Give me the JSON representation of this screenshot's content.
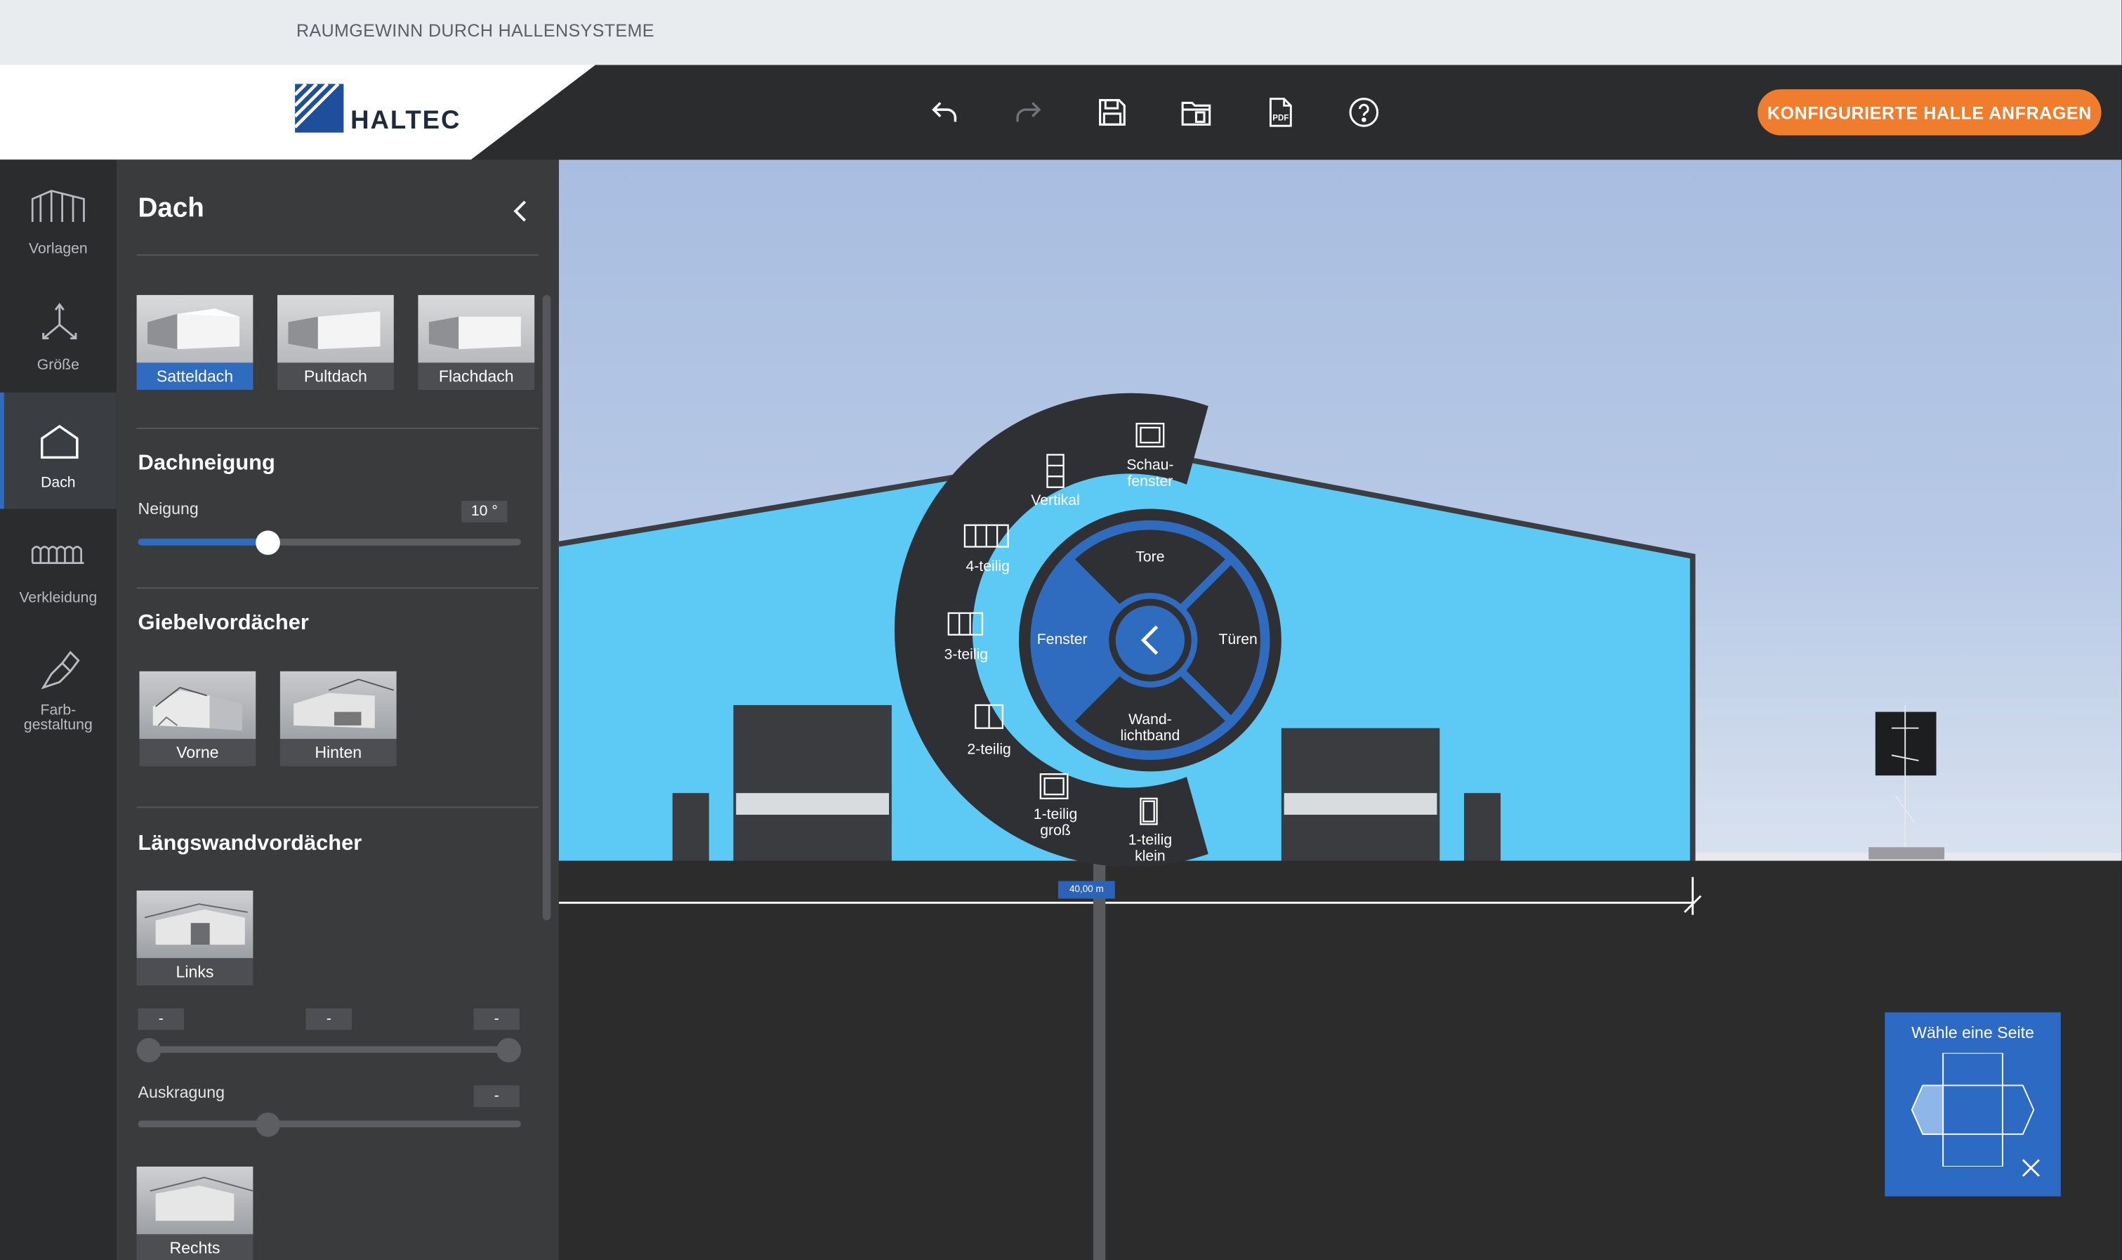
{
  "tagline": "RAUMGEWINN DURCH HALLENSYSTEME",
  "brand": {
    "name": "HALTEC"
  },
  "toolbar": {
    "undo_icon": "undo-icon",
    "redo_icon": "redo-icon",
    "save_icon": "save-icon",
    "load_icon": "folder-icon",
    "pdf_icon": "pdf-icon",
    "help_icon": "help-icon",
    "cta_label": "KONFIGURIERTE HALLE ANFRAGEN",
    "cta_color": "#f07c2e"
  },
  "nav": {
    "items": [
      {
        "label": "Vorlagen",
        "icon": "hall-icon"
      },
      {
        "label": "Größe",
        "icon": "axes-icon"
      },
      {
        "label": "Dach",
        "icon": "roof-icon",
        "active": true
      },
      {
        "label": "Verkleidung",
        "icon": "cladding-icon"
      },
      {
        "label": "Farb-",
        "label2": "gestaltung",
        "icon": "paint-brush-icon"
      }
    ]
  },
  "panel": {
    "title": "Dach",
    "roof_types": [
      "Satteldach",
      "Pultdach",
      "Flachdach"
    ],
    "selected_roof": "Satteldach",
    "pitch_section": "Dachneigung",
    "pitch_label": "Neigung",
    "pitch_value": "10 °",
    "pitch_fraction": 0.34,
    "gable_section": "Giebelvordächer",
    "gable_options": [
      "Vorne",
      "Hinten"
    ],
    "long_section": "Längswandvordächer",
    "left_label": "Links",
    "range_values": [
      "-",
      "-",
      "-"
    ],
    "overhang_label": "Auskragung",
    "overhang_value": "-",
    "right_label": "Rechts"
  },
  "radial": {
    "center_icon": "chevron-left-icon",
    "inner": {
      "top": "Tore",
      "right": "Türen",
      "bottom1": "Wand-",
      "bottom2": "lichtband",
      "left": "Fenster"
    },
    "outer": [
      {
        "l1": "Schau-",
        "l2": "fenster"
      },
      {
        "l1": "Vertikal",
        "l2": ""
      },
      {
        "l1": "4-teilig",
        "l2": ""
      },
      {
        "l1": "3-teilig",
        "l2": ""
      },
      {
        "l1": "2-teilig",
        "l2": ""
      },
      {
        "l1": "1-teilig",
        "l2": "groß"
      },
      {
        "l1": "1-teilig",
        "l2": "klein"
      }
    ]
  },
  "measure": "40,00 m",
  "side_chip": {
    "title": "Wähle eine Seite"
  },
  "colors": {
    "wall": "#5ccaf5",
    "accent": "#2f6bbf",
    "panel": "#3a3b3d",
    "header": "#2b2c2e"
  }
}
